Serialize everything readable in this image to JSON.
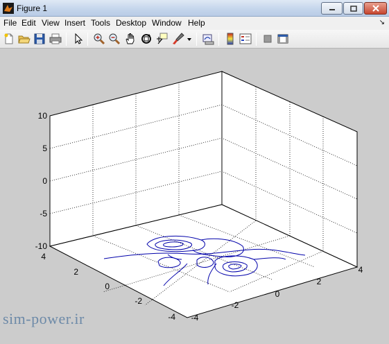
{
  "window": {
    "title": "Figure 1",
    "buttons": {
      "minimize": "minimize-icon",
      "maximize": "maximize-icon",
      "close": "close-icon"
    }
  },
  "menu": {
    "items": [
      "File",
      "Edit",
      "View",
      "Insert",
      "Tools",
      "Desktop",
      "Window",
      "Help"
    ],
    "dock_arrow": "↘"
  },
  "toolbar": {
    "icons": [
      "new-figure-icon",
      "open-file-icon",
      "save-icon",
      "print-icon",
      "pointer-icon",
      "zoom-in-icon",
      "zoom-out-icon",
      "pan-icon",
      "rotate-3d-icon",
      "data-cursor-icon",
      "brush-icon",
      "brush-dropdown-icon",
      "link-plot-icon",
      "colorbar-icon",
      "legend-icon",
      "hide-plot-tools-icon",
      "show-plot-tools-icon"
    ]
  },
  "plot": {
    "z_ticks": [
      "10",
      "5",
      "0",
      "-5",
      "-10"
    ],
    "y_ticks": [
      "4",
      "2",
      "0",
      "-2",
      "-4"
    ],
    "x_ticks": [
      "-4",
      "-2",
      "0",
      "2",
      "4"
    ],
    "line_color": "#0000aa",
    "grid": "dotted"
  },
  "chart_data": {
    "type": "contour3",
    "xlim": [
      -4,
      4
    ],
    "ylim": [
      -4,
      4
    ],
    "zlim": [
      -10,
      10
    ],
    "x_ticks": [
      -4,
      -2,
      0,
      2,
      4
    ],
    "y_ticks": [
      -4,
      -2,
      0,
      2,
      4
    ],
    "z_ticks": [
      -10,
      -5,
      0,
      5,
      10
    ],
    "grid": true,
    "contour_plane_z": -10
  },
  "watermark": "sim-power.ir"
}
